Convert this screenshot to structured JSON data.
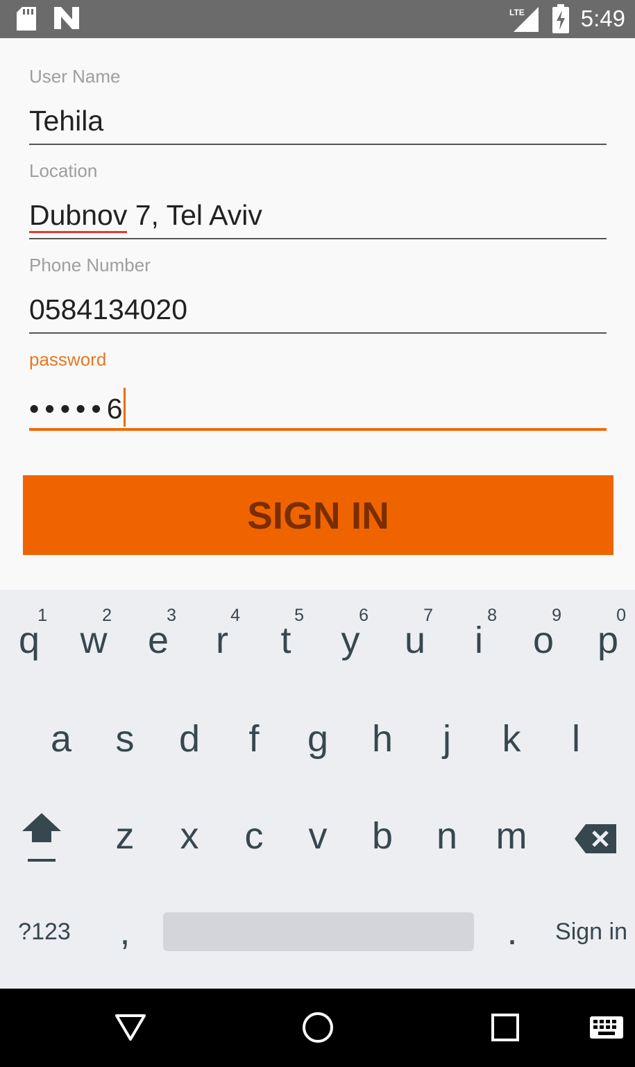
{
  "status_bar": {
    "icons": [
      "sd-card-icon",
      "n-notification-icon",
      "lte-signal-icon",
      "battery-charging-icon"
    ],
    "network_label": "LTE",
    "time": "5:49"
  },
  "form": {
    "username": {
      "label": "User Name",
      "value": "Tehila"
    },
    "location": {
      "label": "Location",
      "value_underlined": "Dubnov",
      "value_rest": " 7, Tel Aviv"
    },
    "phone": {
      "label": "Phone Number",
      "value": "0584134020"
    },
    "password": {
      "label": "password",
      "masked": "•••••",
      "last_char": "6"
    },
    "signin_button": "SIGN IN"
  },
  "keyboard": {
    "row1": [
      {
        "key": "q",
        "hint": "1"
      },
      {
        "key": "w",
        "hint": "2"
      },
      {
        "key": "e",
        "hint": "3"
      },
      {
        "key": "r",
        "hint": "4"
      },
      {
        "key": "t",
        "hint": "5"
      },
      {
        "key": "y",
        "hint": "6"
      },
      {
        "key": "u",
        "hint": "7"
      },
      {
        "key": "i",
        "hint": "8"
      },
      {
        "key": "o",
        "hint": "9"
      },
      {
        "key": "p",
        "hint": "0"
      }
    ],
    "row2": [
      "a",
      "s",
      "d",
      "f",
      "g",
      "h",
      "j",
      "k",
      "l"
    ],
    "row3": [
      "z",
      "x",
      "c",
      "v",
      "b",
      "n",
      "m"
    ],
    "symbols_key": "?123",
    "comma_key": ",",
    "period_key": ".",
    "action_key": "Sign in",
    "special_icons": [
      "shift-icon",
      "backspace-icon"
    ]
  },
  "nav_bar": {
    "icons": [
      "back-icon",
      "home-icon",
      "recents-icon",
      "keyboard-switch-icon"
    ]
  },
  "colors": {
    "accent": "#f06400",
    "button_text": "#7a2e00",
    "status_bar": "#6b6b6b",
    "keyboard_bg": "#eceef2",
    "key_text": "#37474f"
  }
}
